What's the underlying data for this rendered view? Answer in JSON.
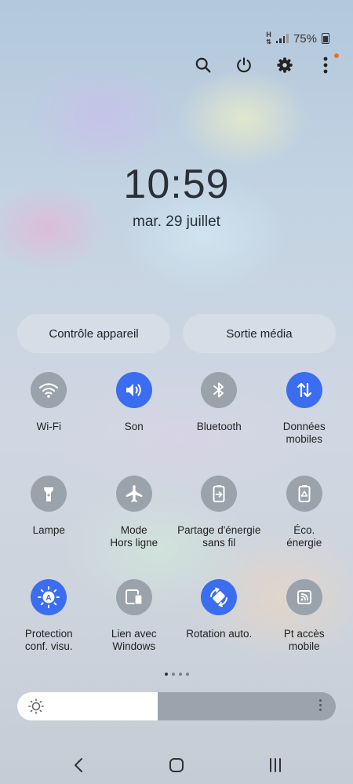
{
  "status_bar": {
    "network_type": "H",
    "battery_percent": "75%",
    "battery_level": 0.75,
    "icons": [
      "mobile-data-icon",
      "signal-icon",
      "battery-icon"
    ]
  },
  "toolbar": {
    "items": [
      {
        "name": "search",
        "icon": "search-icon"
      },
      {
        "name": "power",
        "icon": "power-icon"
      },
      {
        "name": "settings",
        "icon": "gear-icon"
      },
      {
        "name": "more",
        "icon": "more-vertical-icon",
        "has_notification": true
      }
    ],
    "notification_color": "#f26a2e"
  },
  "clock": {
    "time": "10:59",
    "date": "mar. 29 juillet"
  },
  "quick_buttons": {
    "device_control": "Contrôle appareil",
    "media_output": "Sortie média"
  },
  "tiles": [
    {
      "label": "Wi-Fi",
      "icon": "wifi-icon",
      "active": false
    },
    {
      "label": "Son",
      "icon": "sound-icon",
      "active": true
    },
    {
      "label": "Bluetooth",
      "icon": "bluetooth-icon",
      "active": false
    },
    {
      "label": "Données\nmobiles",
      "icon": "mobile-data-icon",
      "active": true
    },
    {
      "label": "Lampe",
      "icon": "flashlight-icon",
      "active": false
    },
    {
      "label": "Mode\nHors ligne",
      "icon": "airplane-icon",
      "active": false
    },
    {
      "label": "Partage d'énergie\nsans fil",
      "icon": "power-share-icon",
      "active": false
    },
    {
      "label": "Éco.\nénergie",
      "icon": "power-saving-icon",
      "active": false
    },
    {
      "label": "Protection\nconf. visu.",
      "icon": "eye-comfort-icon",
      "active": true
    },
    {
      "label": "Lien avec\nWindows",
      "icon": "link-to-windows-icon",
      "active": false
    },
    {
      "label": "Rotation auto.",
      "icon": "auto-rotate-icon",
      "active": true
    },
    {
      "label": "Pt accès\nmobile",
      "icon": "hotspot-icon",
      "active": false
    }
  ],
  "page_indicator": {
    "pages": 4,
    "current": 1
  },
  "brightness": {
    "level": 0.44,
    "icon": "sun-icon"
  },
  "navigation": [
    "back-icon",
    "home-icon",
    "recents-icon"
  ],
  "colors": {
    "accent": "#3a6df0",
    "tile_off": "#9aa2ac"
  }
}
